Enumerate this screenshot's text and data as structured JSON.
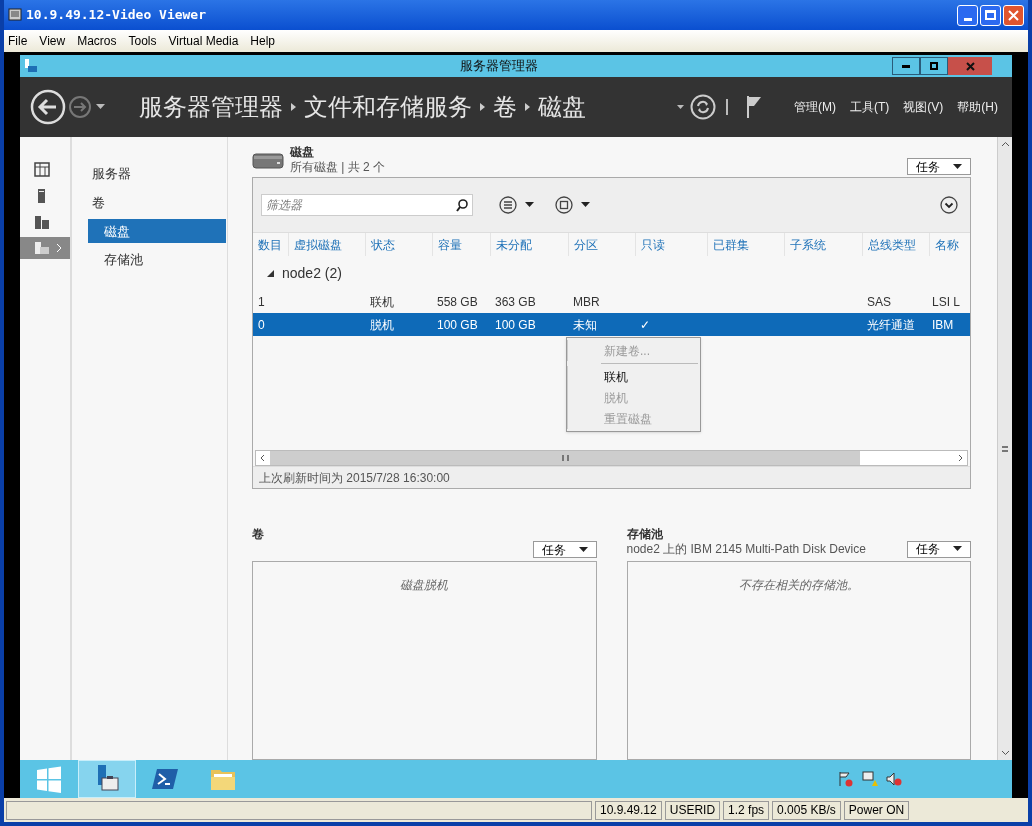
{
  "window": {
    "title": "10.9.49.12-Video Viewer"
  },
  "menu": [
    "File",
    "View",
    "Macros",
    "Tools",
    "Virtual Media",
    "Help"
  ],
  "server_manager": {
    "title": "服务器管理器",
    "breadcrumb": [
      "服务器管理器",
      "文件和存储服务",
      "卷",
      "磁盘"
    ],
    "header_menu": [
      "管理(M)",
      "工具(T)",
      "视图(V)",
      "帮助(H)"
    ],
    "rail": [
      {
        "selected": false
      },
      {
        "selected": false
      },
      {
        "selected": false
      },
      {
        "selected": true
      }
    ],
    "nav": [
      {
        "label": "服务器",
        "selected": false,
        "indent": false
      },
      {
        "label": "卷",
        "selected": false,
        "indent": false
      },
      {
        "label": "磁盘",
        "selected": true,
        "indent": true
      },
      {
        "label": "存储池",
        "selected": false,
        "indent": true
      }
    ],
    "disks": {
      "title": "磁盘",
      "subtitle": "所有磁盘 | 共 2 个",
      "tasks": "任务",
      "filter_placeholder": "筛选器",
      "columns": [
        "数目",
        "虚拟磁盘",
        "状态",
        "容量",
        "未分配",
        "分区",
        "只读",
        "已群集",
        "子系统",
        "总线类型",
        "名称"
      ],
      "group": "node2 (2)",
      "rows": [
        {
          "number": "1",
          "status": "联机",
          "capacity": "558 GB",
          "unallocated": "363 GB",
          "partition": "MBR",
          "bus_type": "SAS",
          "name": "LSI L",
          "selected": false
        },
        {
          "number": "0",
          "status": "脱机",
          "capacity": "100 GB",
          "unallocated": "100 GB",
          "partition": "未知",
          "read_only": "✓",
          "bus_type": "光纤通道",
          "name": "IBM",
          "selected": true
        }
      ],
      "context_menu": [
        {
          "kind": "item",
          "label": "新建卷...",
          "disabled": true
        },
        {
          "kind": "separator"
        },
        {
          "kind": "item",
          "label": "联机",
          "disabled": false
        },
        {
          "kind": "item",
          "label": "脱机",
          "disabled": true
        },
        {
          "kind": "item",
          "label": "重置磁盘",
          "disabled": true
        }
      ],
      "refreshed": "上次刷新时间为 2015/7/28 16:30:00"
    },
    "volumes": {
      "title": "卷",
      "tasks": "任务",
      "empty": "磁盘脱机"
    },
    "storage_pools": {
      "title": "存储池",
      "subtitle": "node2 上的 IBM 2145  Multi-Path Disk Device",
      "tasks": "任务",
      "empty": "不存在相关的存储池。"
    }
  },
  "taskbar": [
    {
      "kind": "start",
      "selected": false
    },
    {
      "kind": "server",
      "selected": true
    },
    {
      "kind": "shell",
      "selected": false
    },
    {
      "kind": "folder",
      "selected": false
    }
  ],
  "status_bar": [
    "10.9.49.12",
    "USERID",
    "1.2 fps",
    "0.005 KB/s",
    "Power ON"
  ]
}
